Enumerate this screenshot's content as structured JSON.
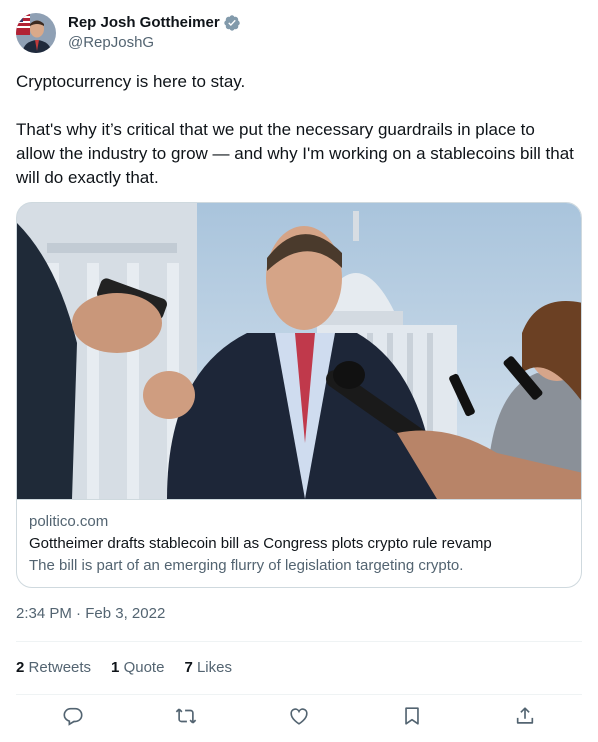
{
  "author": {
    "name": "Rep Josh Gottheimer",
    "handle": "@RepJoshG",
    "verified": true
  },
  "tweet": {
    "paragraphs": [
      "Cryptocurrency is here to stay.",
      "That's why it’s critical that we put the necessary guardrails in place to allow the industry to grow — and why I'm working on a stablecoins bill that will do exactly that."
    ]
  },
  "card": {
    "domain": "politico.com",
    "title": "Gottheimer drafts stablecoin bill as Congress plots crypto rule revamp",
    "description": "The bill is part of an emerging flurry of legislation targeting crypto."
  },
  "timestamp": {
    "time": "2:34 PM",
    "separator": "·",
    "date": "Feb 3, 2022"
  },
  "stats": {
    "retweets_count": "2",
    "retweets_label": "Retweets",
    "quotes_count": "1",
    "quotes_label": "Quote",
    "likes_count": "7",
    "likes_label": "Likes"
  },
  "actions": [
    "reply-icon",
    "retweet-icon",
    "like-icon",
    "bookmark-icon",
    "share-icon"
  ],
  "colors": {
    "text": "#0f1419",
    "secondary": "#536471",
    "border": "#cfd9de",
    "verified": "#829aab"
  }
}
